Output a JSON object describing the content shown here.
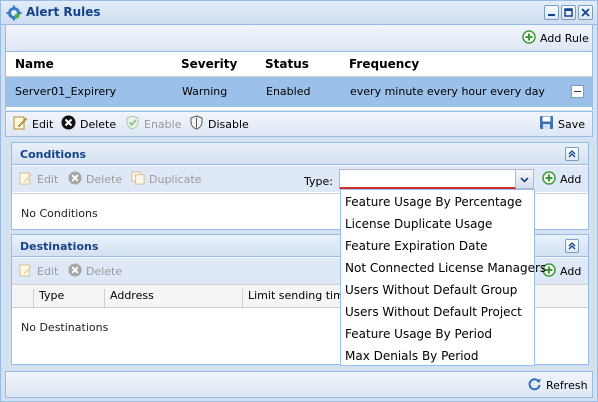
{
  "window": {
    "title": "Alert Rules",
    "icons": {
      "app": "gear-bell-icon",
      "minimize": "minimize-icon",
      "maximize": "maximize-icon",
      "close": "close-icon"
    }
  },
  "toolbar_top": {
    "add_rule": "Add Rule"
  },
  "grid": {
    "columns": [
      "Name",
      "Severity",
      "Status",
      "Frequency"
    ],
    "rows": [
      {
        "name": "Server01_Expirery",
        "severity": "Warning",
        "status": "Enabled",
        "frequency": "every minute every hour every day"
      }
    ]
  },
  "toolbar_mid": {
    "edit": "Edit",
    "delete": "Delete",
    "enable": "Enable",
    "disable": "Disable",
    "save": "Save"
  },
  "conditions": {
    "title": "Conditions",
    "toolbar": {
      "edit": "Edit",
      "delete": "Delete",
      "duplicate": "Duplicate",
      "type_label": "Type:",
      "add": "Add"
    },
    "empty_text": "No Conditions"
  },
  "type_dropdown": {
    "value": "",
    "options": [
      "Feature Usage By Percentage",
      "License Duplicate Usage",
      "Feature Expiration Date",
      "Not Connected License Managers",
      "Users Without Default Group",
      "Users Without Default Project",
      "Feature Usage By Period",
      "Max Denials By Period"
    ]
  },
  "destinations": {
    "title": "Destinations",
    "toolbar": {
      "edit": "Edit",
      "delete": "Delete",
      "add": "Add"
    },
    "columns": [
      "Type",
      "Address",
      "Limit sending times"
    ],
    "empty_text": "No Destinations"
  },
  "bottom": {
    "refresh": "Refresh"
  },
  "colors": {
    "accent": "#15428b",
    "selected_row": "#9bc0ea",
    "border": "#99bbe8",
    "invalid": "#cc3333",
    "add_green": "#3a9a3a"
  }
}
